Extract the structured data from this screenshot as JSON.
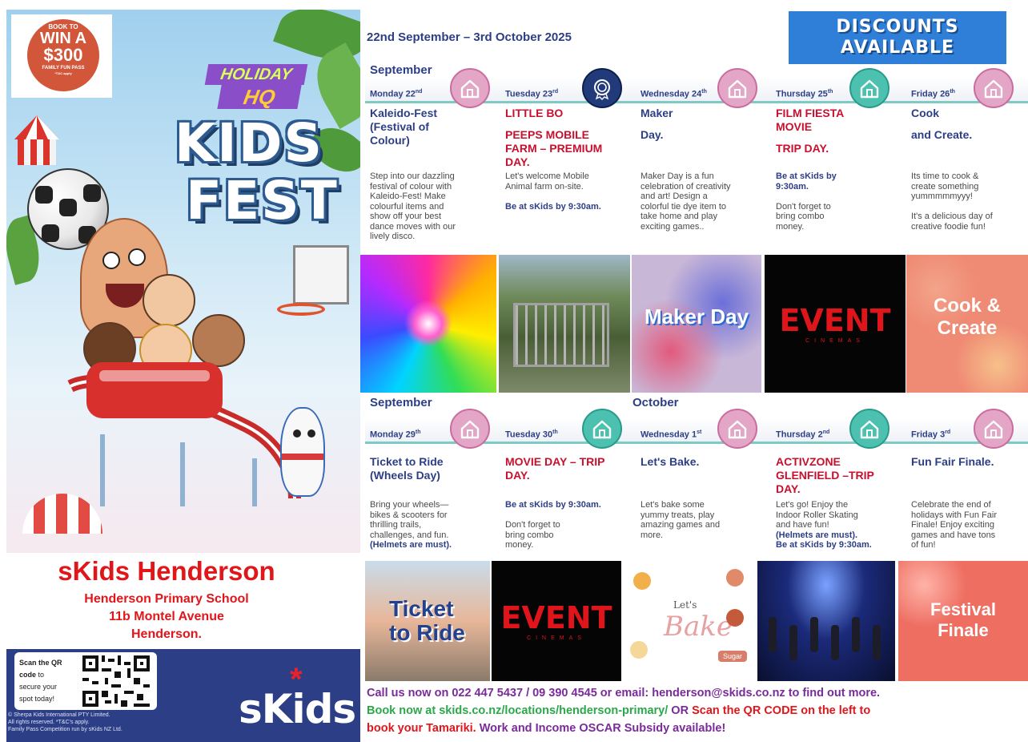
{
  "promo": {
    "line1": "BOOK TO",
    "line2": "WIN A",
    "line3": "$300",
    "line4": "FAMILY FUN PASS",
    "line5": "*T&C apply"
  },
  "poster": {
    "logo_top": "HOLIDAY",
    "logo_bottom": "HQ",
    "word1": "KIDS",
    "word2": "FEST"
  },
  "location": {
    "title": "sKids Henderson",
    "school": "Henderson Primary School",
    "street": "11b Montel Avenue",
    "suburb": "Henderson."
  },
  "qr": {
    "line1_bold": "Scan the QR",
    "line2_bold": "code",
    "line2_rest": " to",
    "line3": "secure your",
    "line4": "spot today!"
  },
  "legal": {
    "line1": "© Sherpa Kids International PTY Limited.",
    "line2": "All rights reserved. *T&C's apply.",
    "line3": "Family Pass Competition run by sKids NZ Ltd."
  },
  "brand": {
    "logo": "sKids",
    "star": "*"
  },
  "header": {
    "date_range": "22nd September – 3rd October 2025",
    "discount_line1": "DISCOUNTS",
    "discount_line2": "AVAILABLE"
  },
  "months": {
    "row1": "September",
    "row2_a": "September",
    "row2_b": "October"
  },
  "badge_kinds": {
    "incursion": {
      "icon": "house-icon",
      "color": "#e3a6c6"
    },
    "excursion": {
      "icon": "house-icon",
      "color": "#4cc1b0"
    },
    "premium": {
      "icon": "medal-icon",
      "color": "#213a7a"
    }
  },
  "week1": [
    {
      "day": "Monday 22",
      "sup": "nd",
      "badge": "incursion",
      "title": [
        "Kaleido-Fest",
        "(Festival of",
        "Colour)"
      ],
      "title_color": "navy",
      "desc": [
        "Step into our dazzling",
        "festival of colour with",
        "Kaleido-Fest! Make",
        "colourful items and",
        "show off your best",
        "dance moves with our",
        "lively disco."
      ],
      "desc_bold": []
    },
    {
      "day": "Tuesday 23",
      "sup": "rd",
      "badge": "premium",
      "title": [
        "LITTLE BO",
        "PEEPS MOBILE",
        "FARM – PREMIUM",
        "DAY."
      ],
      "title_color": "red",
      "desc": [
        "Let's welcome Mobile",
        "Animal farm on-site.",
        ""
      ],
      "desc_bold": [
        "Be at sKids by 9:30am."
      ]
    },
    {
      "day": "Wednesday 24",
      "sup": "th",
      "badge": "incursion",
      "title": [
        "Maker",
        "Day."
      ],
      "title_color": "navy",
      "desc": [
        "Maker Day is a fun",
        "celebration of creativity",
        "and art! Design a",
        "colorful tie dye  item to",
        "take home and play",
        "exciting games.."
      ],
      "desc_bold": []
    },
    {
      "day": "Thursday 25",
      "sup": "th",
      "badge": "excursion",
      "title": [
        "FILM FIESTA",
        "MOVIE",
        "TRIP DAY."
      ],
      "title_color": "red",
      "desc_bold_first": [
        "Be at sKids by",
        "9:30am."
      ],
      "desc": [
        "",
        "Don't forget to",
        "bring combo",
        "money."
      ],
      "desc_bold": []
    },
    {
      "day": "Friday 26",
      "sup": "th",
      "badge": "incursion",
      "title": [
        "Cook",
        "and Create."
      ],
      "title_color": "navy",
      "desc": [
        "Its time to cook &",
        "create something",
        "yummmmmyyy!",
        "",
        "It's a delicious day of",
        "creative foodie fun!"
      ],
      "desc_bold": []
    }
  ],
  "week1_photos": [
    {
      "name": "kaleidoscope-photo",
      "caption": ""
    },
    {
      "name": "animal-farm-photo",
      "caption": ""
    },
    {
      "name": "maker-day-photo",
      "caption": "Maker Day"
    },
    {
      "name": "event-cinemas-photo",
      "caption": "EVENT",
      "subcaption": "CINEMAS"
    },
    {
      "name": "cook-create-photo",
      "caption": "Cook &",
      "caption2": "Create"
    }
  ],
  "week2": [
    {
      "day": "Monday 29",
      "sup": "th",
      "badge": "incursion",
      "title": [
        "Ticket to Ride",
        "(Wheels Day)"
      ],
      "title_color": "navy",
      "desc": [
        "Bring your wheels—",
        "bikes & scooters for",
        "thrilling trails,",
        "challenges, and fun."
      ],
      "desc_bold": [
        "(Helmets are must)."
      ]
    },
    {
      "day": "Tuesday 30",
      "sup": "th",
      "badge": "excursion",
      "title": [
        "MOVIE DAY – TRIP",
        "DAY."
      ],
      "title_color": "red",
      "desc_bold_first": [
        "Be at sKids by 9:30am."
      ],
      "desc": [
        "",
        "Don't forget to",
        "bring combo",
        "money."
      ],
      "desc_bold": []
    },
    {
      "day": "Wednesday 1",
      "sup": "st",
      "badge": "incursion",
      "title": [
        "Let's Bake."
      ],
      "title_color": "navy",
      "desc": [
        "Let's bake some",
        "yummy treats, play",
        "amazing games and",
        "more."
      ],
      "desc_bold": []
    },
    {
      "day": "Thursday 2",
      "sup": "nd",
      "badge": "excursion",
      "title": [
        "ACTIVZONE",
        "GLENFIELD –TRIP",
        "DAY."
      ],
      "title_color": "red",
      "desc": [
        "Let's go!  Enjoy the",
        "Indoor Roller Skating",
        "and have fun!"
      ],
      "desc_bold": [
        "(Helmets are must).",
        "Be at sKids by 9:30am."
      ]
    },
    {
      "day": "Friday 3",
      "sup": "rd",
      "badge": "incursion",
      "title": [
        "Fun Fair Finale."
      ],
      "title_color": "navy",
      "desc": [
        "Celebrate the end of",
        "holidays with Fun Fair",
        "Finale! Enjoy exciting",
        "games and have tons",
        "of fun!"
      ],
      "desc_bold": []
    }
  ],
  "week2_photos": [
    {
      "name": "ticket-to-ride-photo",
      "caption": "Ticket",
      "caption2": "to Ride"
    },
    {
      "name": "event-cinemas-photo",
      "caption": "EVENT",
      "subcaption": "CINEMAS"
    },
    {
      "name": "lets-bake-photo",
      "caption": "Let's",
      "caption2": "Bake",
      "caption3": "Sugar"
    },
    {
      "name": "roller-skating-photo",
      "caption": ""
    },
    {
      "name": "festival-finale-photo",
      "caption": "Festival",
      "caption2": "Finale"
    }
  ],
  "footer": {
    "line1": "Call us now on 022 447 5437 / 09 390 4545 or email: henderson@skids.co.nz to find out more.",
    "line2_green": "Book now at skids.co.nz/locations/henderson-primary/",
    "line2_purple": " OR ",
    "line2_red": "Scan the QR CODE on the left to",
    "line3_red": "book your Tamariki.",
    "line3_purple": "  Work and Income OSCAR Subsidy available!"
  }
}
